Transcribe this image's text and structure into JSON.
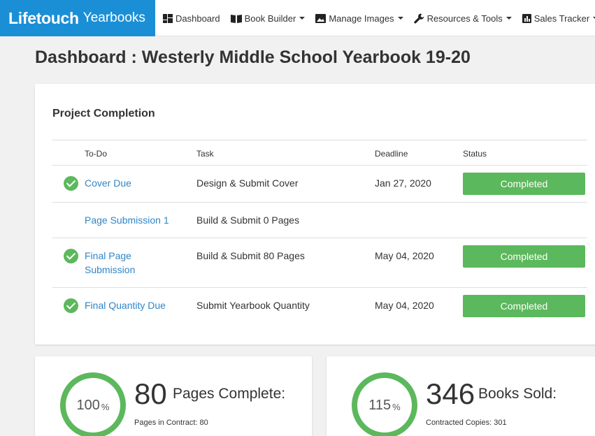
{
  "logo": {
    "brand": "Lifetouch",
    "sub": "Yearbooks"
  },
  "nav": [
    {
      "label": "Dashboard",
      "icon": "dashboard-icon",
      "caret": false
    },
    {
      "label": "Book Builder",
      "icon": "book-icon",
      "caret": true
    },
    {
      "label": "Manage Images",
      "icon": "image-icon",
      "caret": true
    },
    {
      "label": "Resources & Tools",
      "icon": "wrench-icon",
      "caret": true
    },
    {
      "label": "Sales Tracker",
      "icon": "bar-chart-icon",
      "caret": true
    }
  ],
  "page_title": "Dashboard : Westerly Middle School Yearbook 19-20",
  "project": {
    "title": "Project Completion",
    "columns": {
      "todo": "To-Do",
      "task": "Task",
      "deadline": "Deadline",
      "status": "Status"
    },
    "rows": [
      {
        "todo": "Cover Due",
        "task": "Design & Submit Cover",
        "deadline": "Jan 27, 2020",
        "status": "Completed",
        "done": true
      },
      {
        "todo": "Page Submission 1",
        "task": "Build & Submit 0 Pages",
        "deadline": "",
        "status": "",
        "done": false
      },
      {
        "todo": "Final Page Submission",
        "task": "Build & Submit 80 Pages",
        "deadline": "May 04, 2020",
        "status": "Completed",
        "done": true
      },
      {
        "todo": "Final Quantity Due",
        "task": "Submit Yearbook Quantity",
        "deadline": "May 04, 2020",
        "status": "Completed",
        "done": true
      }
    ]
  },
  "stats": {
    "pages": {
      "percent": "100",
      "unit": "%",
      "number": "80",
      "label": "Pages Complete:",
      "sub": "Pages in Contract: 80"
    },
    "books": {
      "percent": "115",
      "unit": "%",
      "number": "346",
      "label": "Books Sold:",
      "sub": "Contracted Copies: 301"
    }
  },
  "colors": {
    "brand": "#1b8fd6",
    "success": "#5cb85c",
    "link": "#2f86c9"
  }
}
